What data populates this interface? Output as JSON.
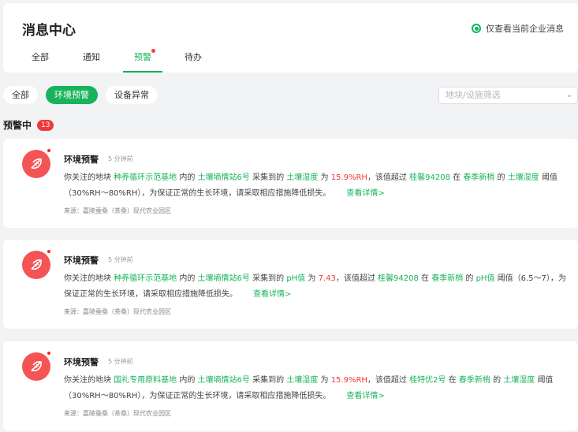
{
  "header": {
    "title": "消息中心",
    "toggle_label": "仅查看当前企业消息",
    "tabs": [
      {
        "label": "全部"
      },
      {
        "label": "通知"
      },
      {
        "label": "预警"
      },
      {
        "label": "待办"
      }
    ]
  },
  "filters": {
    "chips": [
      {
        "label": "全部"
      },
      {
        "label": "环境预警"
      },
      {
        "label": "设备异常"
      }
    ],
    "select_placeholder": "地块/设施筛选"
  },
  "section": {
    "label": "预警中",
    "count": "13"
  },
  "messages": [
    {
      "title": "环境预警",
      "time": "5 分钟前",
      "p1": "你关注的地块",
      "plot": "种养循环示范基地",
      "p2": "内的",
      "station": "土壤墒情站6号",
      "p3": "采集到的",
      "metric": "土壤湿度",
      "p4": "为",
      "value": "15.9%RH",
      "p5": "，该值超过",
      "variety": "桂馨94208",
      "p6": "在",
      "stage": "春季新梢",
      "p7": "的",
      "metric2": "土壤湿度",
      "p8": "阈值（30%RH～80%RH），为保证正常的生长环境，请采取相应措施降低损失。",
      "detail": "查看详情>",
      "source": "来源：嘉陵蚕桑（茶桑）现代农业园区"
    },
    {
      "title": "环境预警",
      "time": "5 分钟前",
      "p1": "你关注的地块",
      "plot": "种养循环示范基地",
      "p2": "内的",
      "station": "土壤墒情站6号",
      "p3": "采集到的",
      "metric": "pH值",
      "p4": "为",
      "value": "7.43",
      "p5": "，该值超过",
      "variety": "桂馨94208",
      "p6": "在",
      "stage": "春季新梢",
      "p7": "的",
      "metric2": "pH值",
      "p8": "阈值（6.5～7），为保证正常的生长环境，请采取相应措施降低损失。",
      "detail": "查看详情>",
      "source": "来源：嘉陵蚕桑（茶桑）现代农业园区"
    },
    {
      "title": "环境预警",
      "time": "5 分钟前",
      "p1": "你关注的地块",
      "plot": "国礼专用原料基地",
      "p2": "内的",
      "station": "土壤墒情站6号",
      "p3": "采集到的",
      "metric": "土壤湿度",
      "p4": "为",
      "value": "15.9%RH",
      "p5": "，该值超过",
      "variety": "桂特优2号",
      "p6": "在",
      "stage": "春季新梢",
      "p7": "的",
      "metric2": "土壤湿度",
      "p8": "阈值（30%RH～80%RH），为保证正常的生长环境，请采取相应措施降低损失。",
      "detail": "查看详情>",
      "source": "来源：嘉陵蚕桑（茶桑）现代农业园区"
    }
  ],
  "colors": {
    "accent": "#18b35b",
    "alert": "#f03a3a",
    "avatar_bg": "#f35454"
  },
  "icons": {
    "warning_avatar": "leaf-alert-icon",
    "select_arrow": "chevron-down-icon"
  }
}
